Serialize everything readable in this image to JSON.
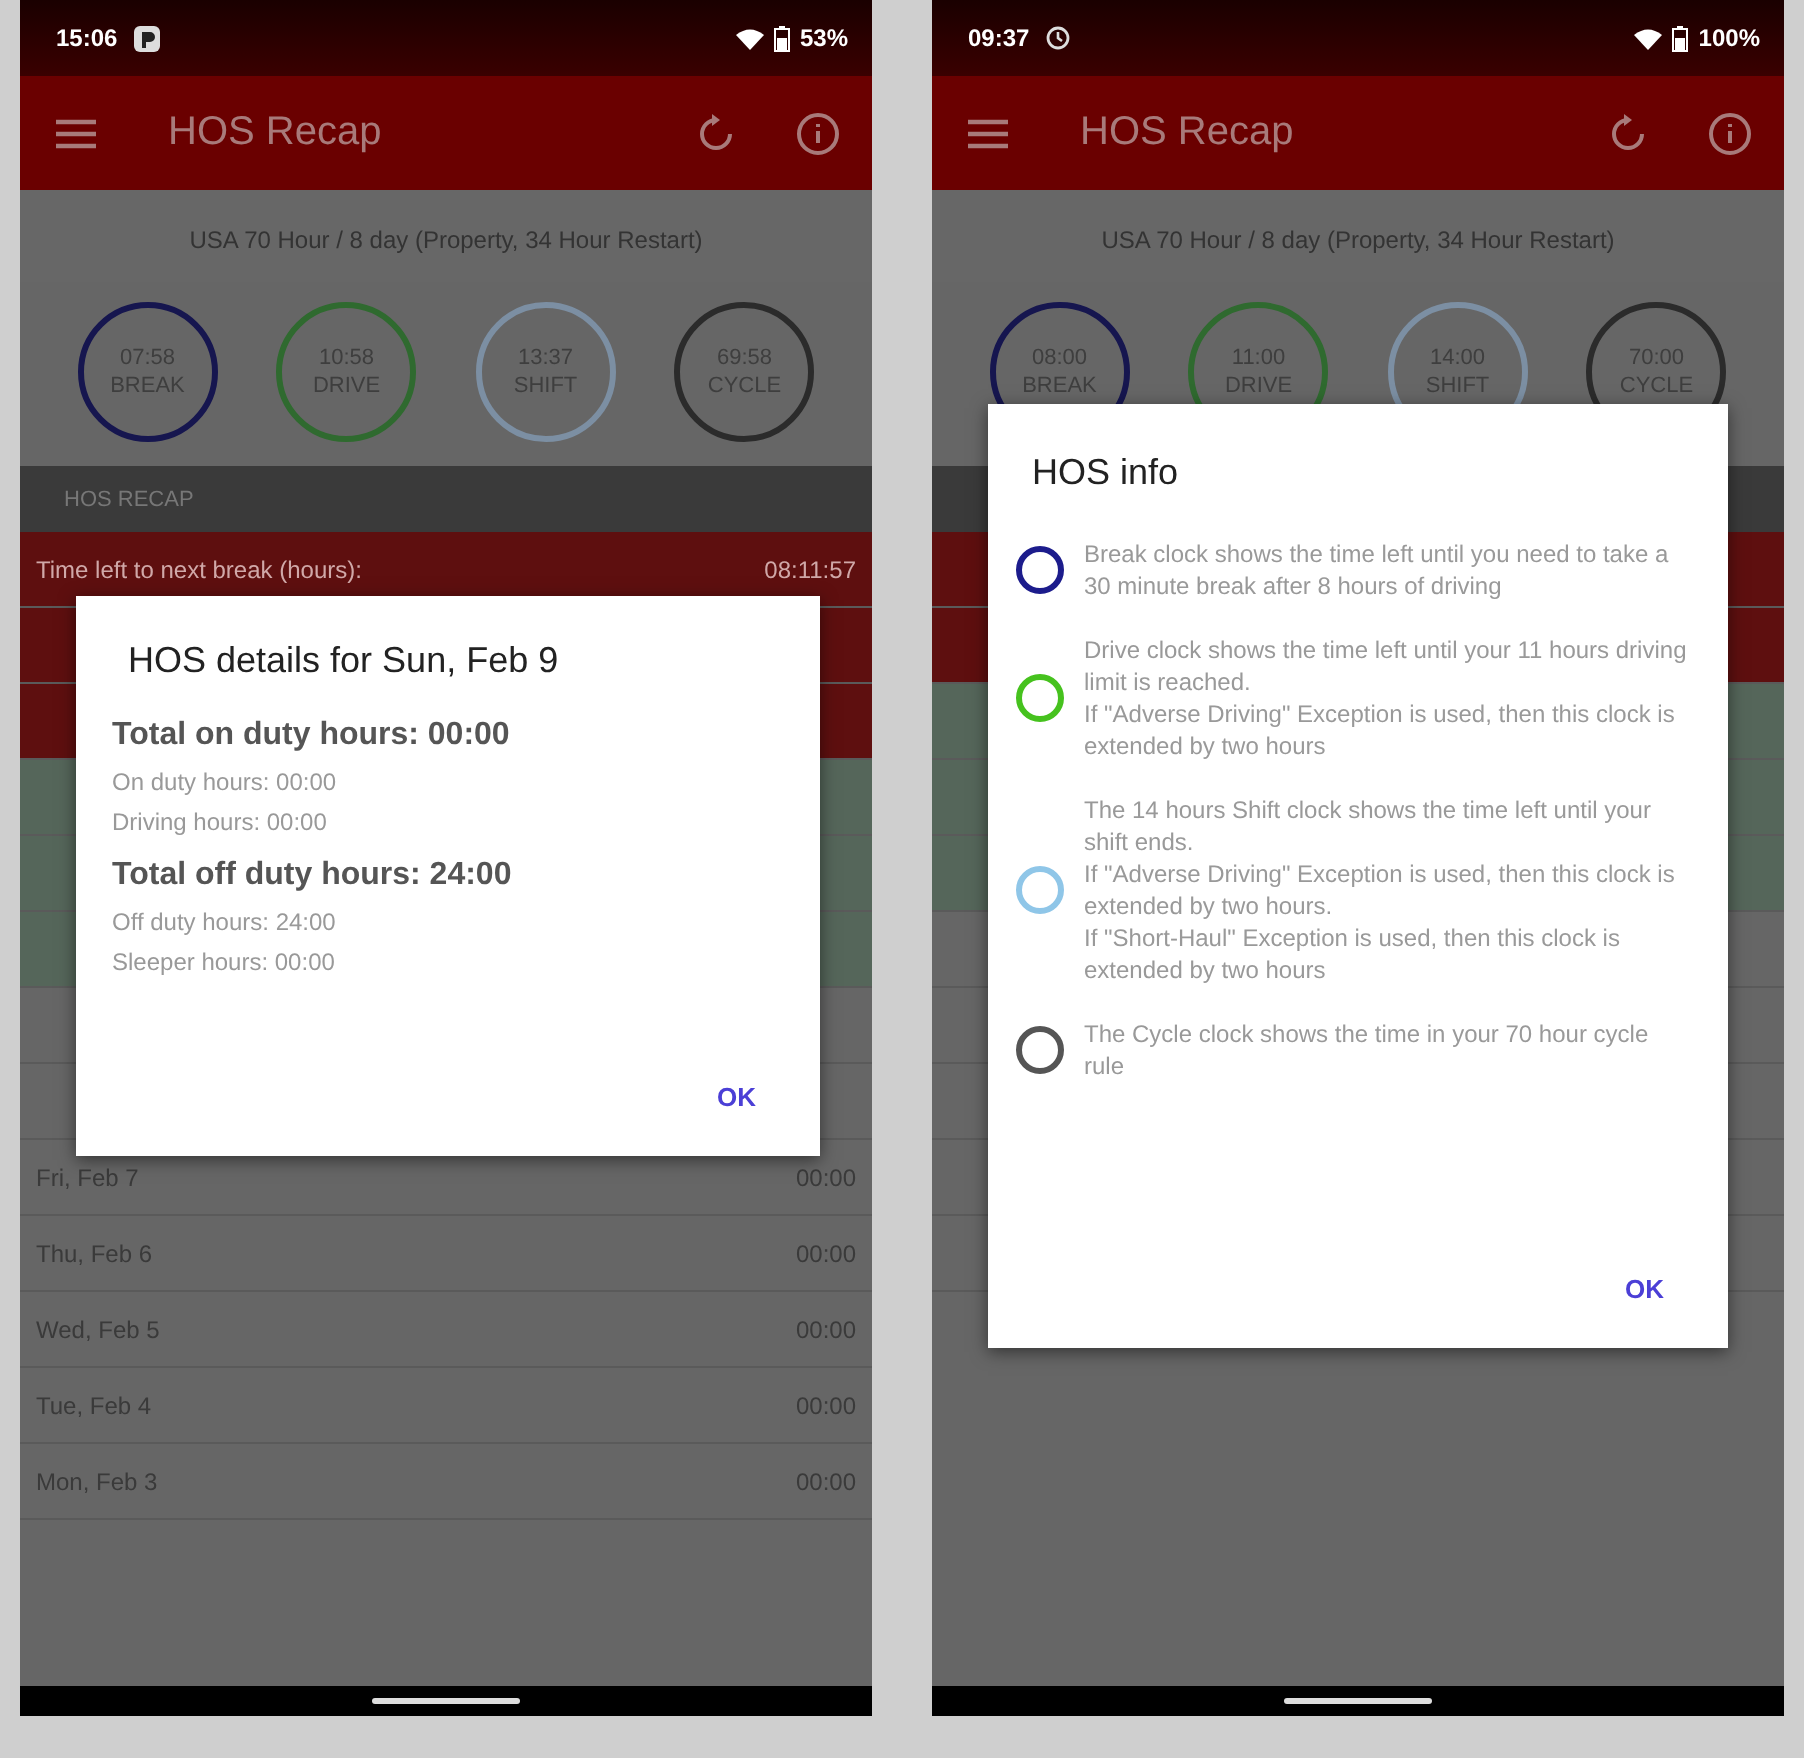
{
  "screens": [
    {
      "status_bar": {
        "time": "15:06",
        "battery": "53%"
      },
      "toolbar": {
        "title": "HOS Recap"
      },
      "ruleset": "USA 70 Hour / 8 day (Property, 34 Hour Restart)",
      "clocks": [
        {
          "time": "07:58",
          "label": "BREAK",
          "color": "#16164f"
        },
        {
          "time": "10:58",
          "label": "DRIVE",
          "color": "#2f6a2f"
        },
        {
          "time": "13:37",
          "label": "SHIFT",
          "color": "#7c8fa3"
        },
        {
          "time": "69:58",
          "label": "CYCLE",
          "color": "#2b2b2b"
        }
      ],
      "section_header": "HOS RECAP",
      "rows": [
        {
          "kind": "alert",
          "label": "Time left to next break (hours):",
          "value": "08:11:57"
        },
        {
          "kind": "alert"
        },
        {
          "kind": "alert"
        },
        {
          "kind": "good"
        },
        {
          "kind": "good"
        },
        {
          "kind": "good"
        },
        {
          "kind": "plain"
        },
        {
          "kind": "plain"
        },
        {
          "kind": "plain",
          "label": "Fri, Feb 7",
          "value": "00:00"
        },
        {
          "kind": "plain",
          "label": "Thu, Feb 6",
          "value": "00:00"
        },
        {
          "kind": "plain",
          "label": "Wed, Feb 5",
          "value": "00:00"
        },
        {
          "kind": "plain",
          "label": "Tue, Feb 4",
          "value": "00:00"
        },
        {
          "kind": "plain",
          "label": "Mon, Feb 3",
          "value": "00:00"
        }
      ],
      "dialog": {
        "kind": "details",
        "title": "HOS details for Sun, Feb 9",
        "sections": [
          {
            "heading": "Total on duty hours: 00:00",
            "lines": [
              "On duty hours: 00:00",
              "Driving hours: 00:00"
            ]
          },
          {
            "heading": "Total off duty hours: 24:00",
            "lines": [
              "Off duty hours: 24:00",
              "Sleeper hours: 00:00"
            ]
          }
        ],
        "button": "OK"
      }
    },
    {
      "status_bar": {
        "time": "09:37",
        "battery": "100%"
      },
      "toolbar": {
        "title": "HOS Recap"
      },
      "ruleset": "USA 70 Hour / 8 day (Property, 34 Hour Restart)",
      "clocks": [
        {
          "time": "08:00",
          "label": "BREAK",
          "color": "#16164f"
        },
        {
          "time": "11:00",
          "label": "DRIVE",
          "color": "#2f6a2f"
        },
        {
          "time": "14:00",
          "label": "SHIFT",
          "color": "#7c8fa3"
        },
        {
          "time": "70:00",
          "label": "CYCLE",
          "color": "#2b2b2b"
        }
      ],
      "rows": [
        {
          "kind": "alert"
        },
        {
          "kind": "alert"
        },
        {
          "kind": "good"
        },
        {
          "kind": "good"
        },
        {
          "kind": "good"
        },
        {
          "kind": "plain"
        },
        {
          "kind": "plain"
        },
        {
          "kind": "plain"
        },
        {
          "kind": "plain"
        },
        {
          "kind": "plain"
        }
      ],
      "dialog": {
        "kind": "legend",
        "title": "HOS info",
        "items": [
          {
            "text": "Break clock shows the time left until you need to take a 30 minute break after 8 hours of driving",
            "color": "#1c1c8c"
          },
          {
            "text": "Drive clock shows the time left until your 11 hours driving limit is reached.\nIf \"Adverse Driving\" Exception is used, then this clock is extended by two hours",
            "color": "#46c21e"
          },
          {
            "text": "The 14 hours Shift clock shows the time left until your shift ends.\nIf \"Adverse Driving\" Exception is used, then this clock is extended by two hours.\nIf \"Short-Haul\" Exception is used, then this clock is extended by two hours",
            "color": "#8fc6e8"
          },
          {
            "text": "The Cycle clock shows the time in your 70 hour cycle rule",
            "color": "#555555"
          }
        ],
        "button": "OK"
      }
    }
  ]
}
